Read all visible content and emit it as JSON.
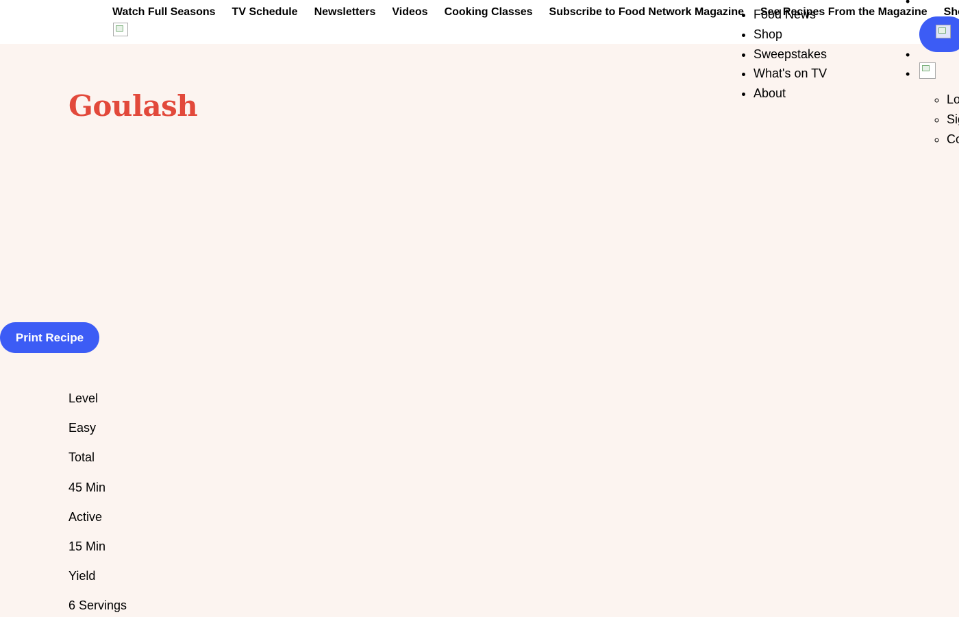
{
  "top_nav": {
    "items": [
      "Watch Full Seasons",
      "TV Schedule",
      "Newsletters",
      "Videos",
      "Cooking Classes",
      "Subscribe to Food Network Magazine",
      "See Recipes From the Magazine",
      "Shows A-Z"
    ]
  },
  "secondary_menu": {
    "items": [
      "Food News",
      "Shop",
      "Sweepstakes",
      "What's on TV",
      "About"
    ]
  },
  "account_menu": {
    "items": [
      "Lo",
      "Sig",
      "Co"
    ]
  },
  "icons": {
    "logo": "broken-image-icon",
    "search": "broken-image-icon",
    "avatar": "broken-image-icon"
  },
  "colors": {
    "page_background": "#fcf4f0",
    "header_background": "#ffffff",
    "title": "#e2493b",
    "accent_button": "#3c5cf5"
  },
  "recipe": {
    "title": "Goulash",
    "print_label": "Print Recipe",
    "level_label": "Level",
    "level_value": "Easy",
    "total_label": "Total",
    "total_value": "45 Min",
    "active_label": "Active",
    "active_value": "15 Min",
    "yield_label": "Yield",
    "yield_value": "6 Servings"
  }
}
